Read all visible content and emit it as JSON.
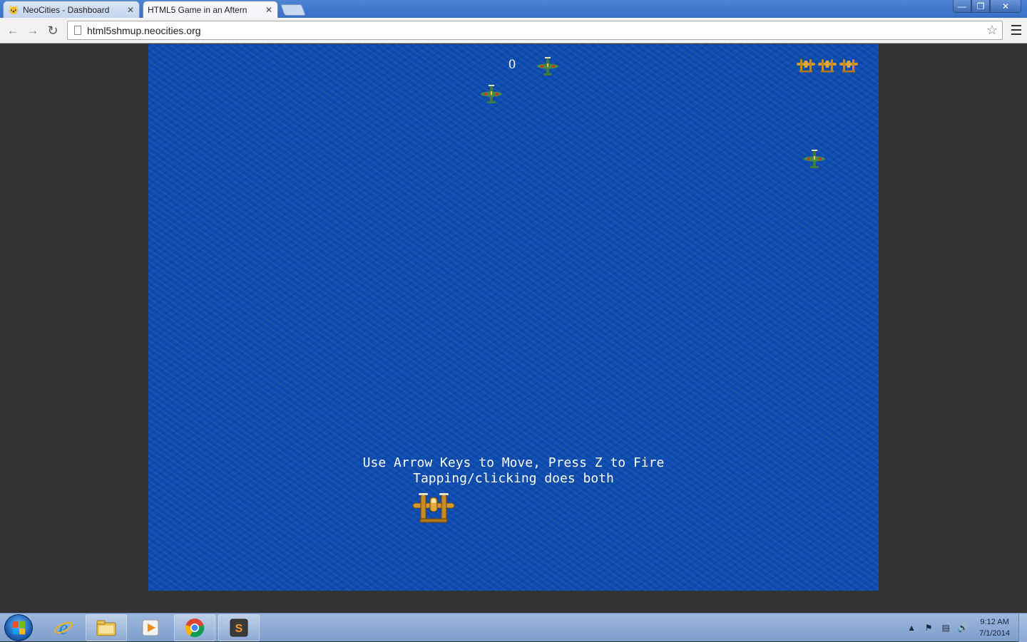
{
  "browser": {
    "tabs": [
      {
        "title": "NeoCities - Dashboard",
        "active": false,
        "favicon": "cat-icon"
      },
      {
        "title": "HTML5 Game in an Aftern",
        "active": true,
        "favicon": "game-icon"
      }
    ],
    "tab_close_glyph": "✕",
    "address": "html5shmup.neocities.org",
    "window_buttons": {
      "minimize": "—",
      "maximize": "❐",
      "close": "✕"
    }
  },
  "game": {
    "score": "0",
    "lives": 3,
    "instructions": [
      "Use Arrow Keys to Move, Press Z to Fire",
      "Tapping/clicking does both"
    ],
    "colors": {
      "sea": "#0d4cae",
      "enemy_plane": "#3f7a3a",
      "player_plane": "#d59a2e"
    }
  },
  "taskbar": {
    "apps": [
      "internet-explorer-icon",
      "file-explorer-icon",
      "media-player-icon",
      "chrome-icon",
      "sublime-text-icon"
    ],
    "clock": {
      "time": "9:12 AM",
      "date": "7/1/2014"
    }
  }
}
